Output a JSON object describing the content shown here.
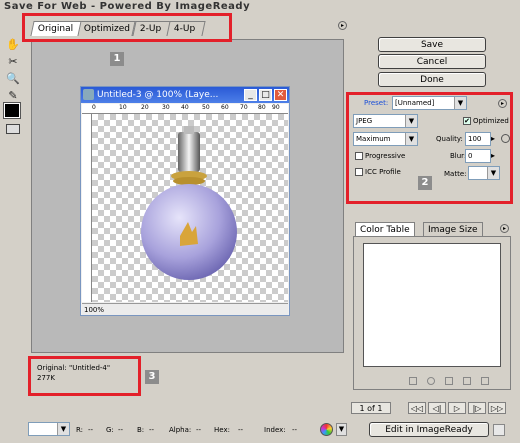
{
  "window": {
    "title": "Save For Web - Powered By ImageReady"
  },
  "tabs": [
    {
      "label": "Original",
      "active": true
    },
    {
      "label": "Optimized",
      "active": false
    },
    {
      "label": "2-Up",
      "active": false
    },
    {
      "label": "4-Up",
      "active": false
    }
  ],
  "callouts": [
    "1",
    "2",
    "3"
  ],
  "tools": [
    "hand-icon",
    "slice-select-icon",
    "zoom-icon",
    "eyedropper-icon",
    "eyedropper-color-icon",
    "toggle-slices-icon"
  ],
  "inner_window": {
    "title": "Untitled-3 @ 100% (Laye...",
    "zoom": "100%",
    "ruler_ticks": [
      "0",
      "10",
      "20",
      "30",
      "40",
      "50",
      "60",
      "70",
      "80",
      "90",
      "100"
    ]
  },
  "info": {
    "line1": "Original: \"Untitled-4\"",
    "line2": "277K"
  },
  "buttons": {
    "save": "Save",
    "cancel": "Cancel",
    "done": "Done",
    "edit": "Edit in ImageReady"
  },
  "settings": {
    "preset_label": "Preset:",
    "preset_value": "[Unnamed]",
    "format": "JPEG",
    "quality_preset": "Maximum",
    "optimized_label": "Optimized",
    "quality_label": "Quality:",
    "quality_value": "100",
    "progressive_label": "Progressive",
    "blur_label": "Blur:",
    "blur_value": "0",
    "icc_label": "ICC Profile",
    "matte_label": "Matte:"
  },
  "panel2": {
    "tab1": "Color Table",
    "tab2": "Image Size"
  },
  "animation": {
    "frame": "1 of 1"
  },
  "status": {
    "r": "R:",
    "g": "G:",
    "b": "B:",
    "alpha": "Alpha:",
    "hex": "Hex:",
    "index": "Index:",
    "dash": "--"
  },
  "colors": {
    "accent_red": "#e3202a",
    "titlebar_blue": "#2a5ad6"
  }
}
